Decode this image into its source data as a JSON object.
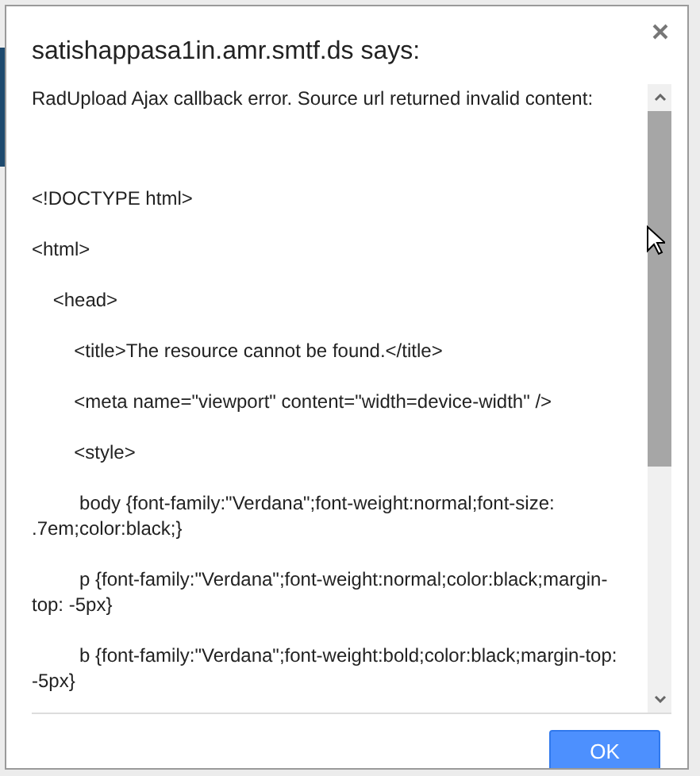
{
  "dialog": {
    "title": "satishappasa1in.amr.smtf.ds says:",
    "message": [
      "RadUpload Ajax callback error. Source url returned invalid content:",
      "<!DOCTYPE html>",
      "<html>",
      "    <head>",
      "        <title>The resource cannot be found.</title>",
      "        <meta name=\"viewport\" content=\"width=device-width\" />",
      "        <style>",
      "         body {font-family:\"Verdana\";font-weight:normal;font-size: .7em;color:black;}",
      "         p {font-family:\"Verdana\";font-weight:normal;color:black;margin-top: -5px}",
      "         b {font-family:\"Verdana\";font-weight:bold;color:black;margin-top: -5px}"
    ],
    "buttons": [
      "OK"
    ]
  }
}
